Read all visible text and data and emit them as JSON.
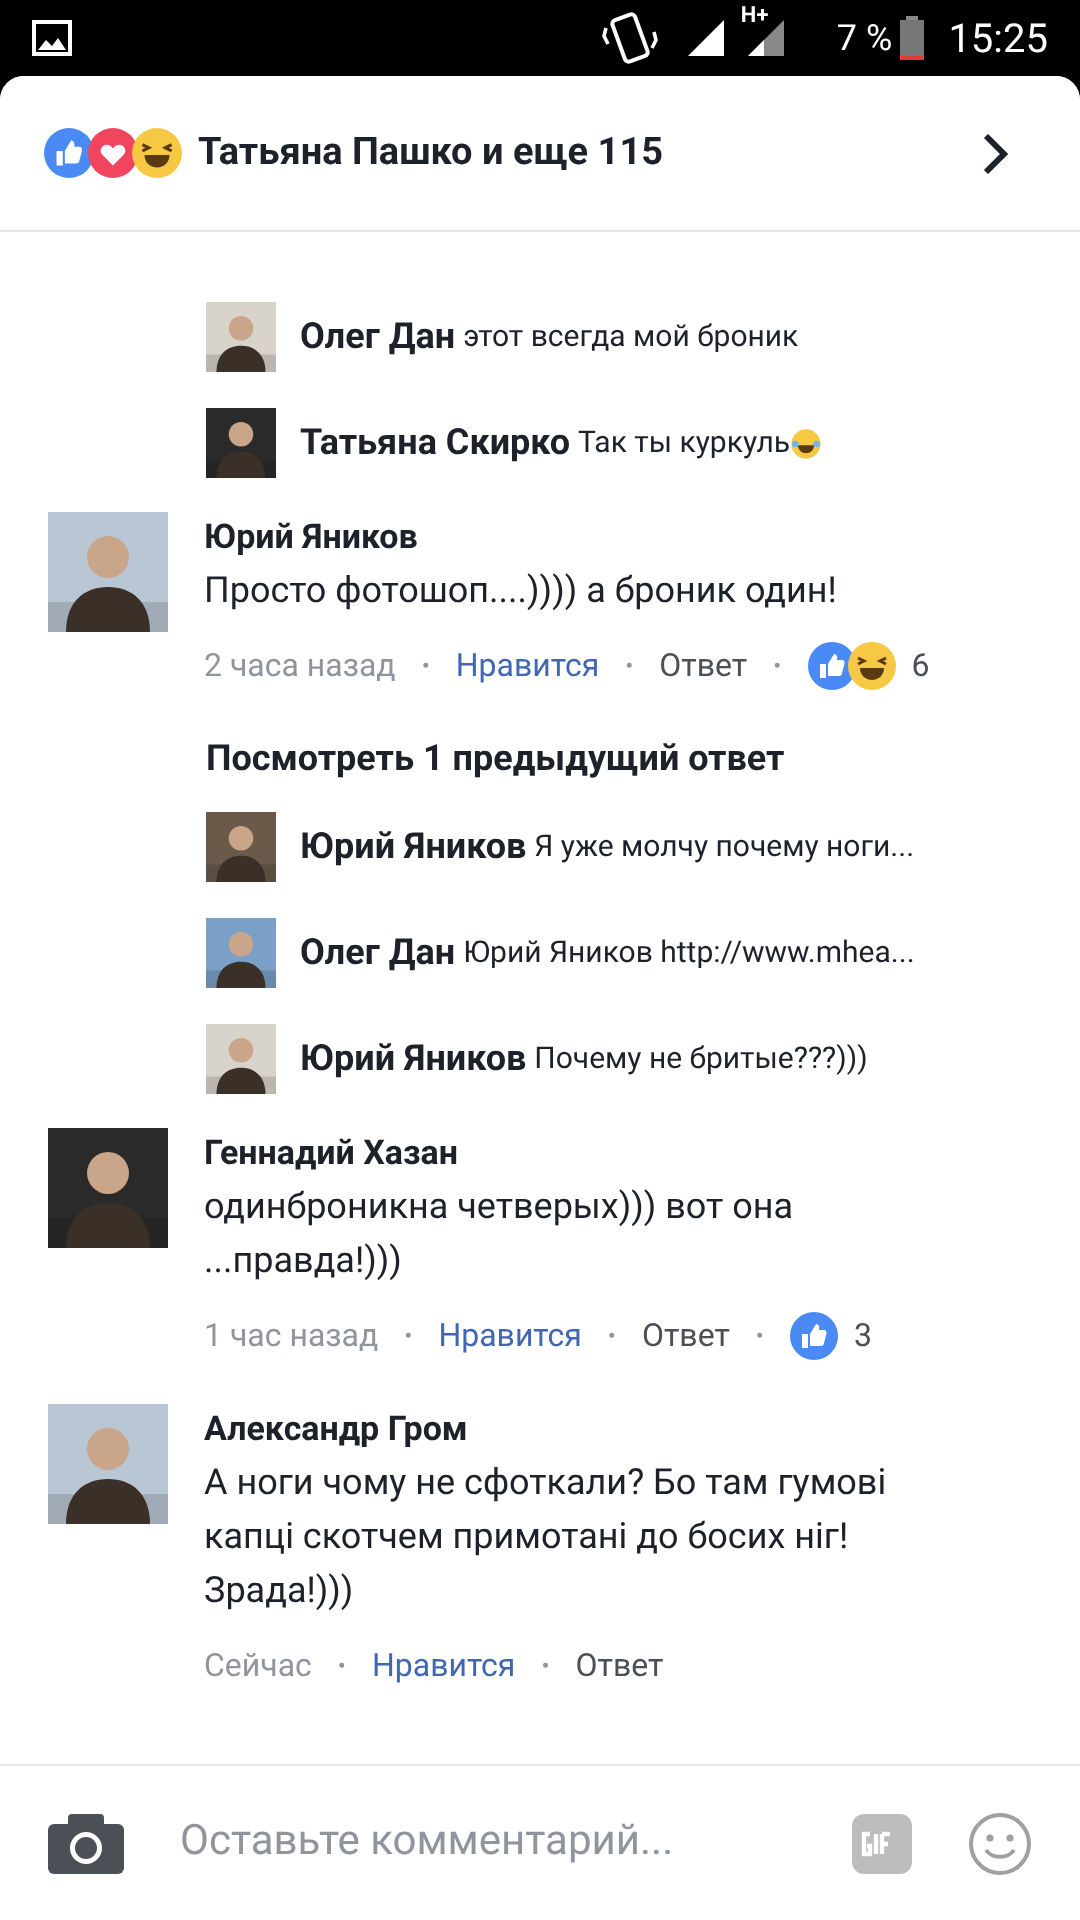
{
  "status_bar": {
    "network": "H+",
    "battery": "7 %",
    "time": "15:25"
  },
  "header": {
    "reactions": [
      {
        "kind": "like"
      },
      {
        "kind": "love"
      },
      {
        "kind": "haha"
      }
    ],
    "title": "Татьяна Пашко и еще 115"
  },
  "items": [
    {
      "kind": "reply",
      "name": "Олег Дан",
      "text": "этот всегда мой броник"
    },
    {
      "kind": "reply",
      "name": "Татьяна Скирко",
      "text": "Так ты куркуль",
      "emoji": {
        "kind": "tears"
      }
    },
    {
      "kind": "comment",
      "name": "Юрий Яников",
      "text": "Просто фотошоп....)))) а броник один!",
      "time": "2 часа назад",
      "separator": "•",
      "like": "Нравится",
      "reply": "Ответ",
      "reactions": [
        {
          "kind": "like"
        },
        {
          "kind": "haha"
        }
      ],
      "count": "6"
    },
    {
      "kind": "more",
      "text": "Посмотреть 1 предыдущий ответ"
    },
    {
      "kind": "reply",
      "name": "Юрий Яников",
      "text": "Я уже молчу почему ноги..."
    },
    {
      "kind": "reply",
      "name": "Олег Дан",
      "text": "Юрий Яников http://www.mhea..."
    },
    {
      "kind": "reply",
      "name": "Юрий Яников",
      "text": "Почему не бритые???)))"
    },
    {
      "kind": "comment",
      "name": "Геннадий Хазан",
      "text": "одинброникна четверых))) вот она ...правда!)))",
      "time": "1 час назад",
      "separator": "•",
      "like": "Нравится",
      "reply": "Ответ",
      "reactions": [
        {
          "kind": "like"
        }
      ],
      "count": "3"
    },
    {
      "kind": "comment",
      "name": "Александр Гром",
      "text": "А ноги чому не сфоткали? Бо там гумові капці скотчем примотані до босих ніг! Зрада!)))",
      "time": "Сейчас",
      "separator": "•",
      "like": "Нравится",
      "reply": "Ответ"
    }
  ],
  "composer": {
    "placeholder": "Оставьте комментарий..."
  }
}
